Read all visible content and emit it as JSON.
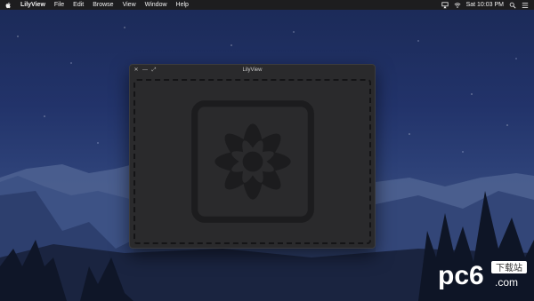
{
  "menubar": {
    "app_name": "LilyView",
    "items": [
      "File",
      "Edit",
      "Browse",
      "View",
      "Window",
      "Help"
    ],
    "clock": "Sat 10:03 PM"
  },
  "window": {
    "title": "LilyView",
    "controls": {
      "close": "✕",
      "minimize": "—",
      "zoom": "⤢"
    }
  },
  "watermark": {
    "text": "pc6",
    "sub": "下载站",
    "domain": ".com"
  },
  "colors": {
    "menubar_bg": "#1d1d1f",
    "window_bg": "#2a2a2c",
    "sky_top": "#1b2a57",
    "icon_fill": "#1c1c1e"
  }
}
